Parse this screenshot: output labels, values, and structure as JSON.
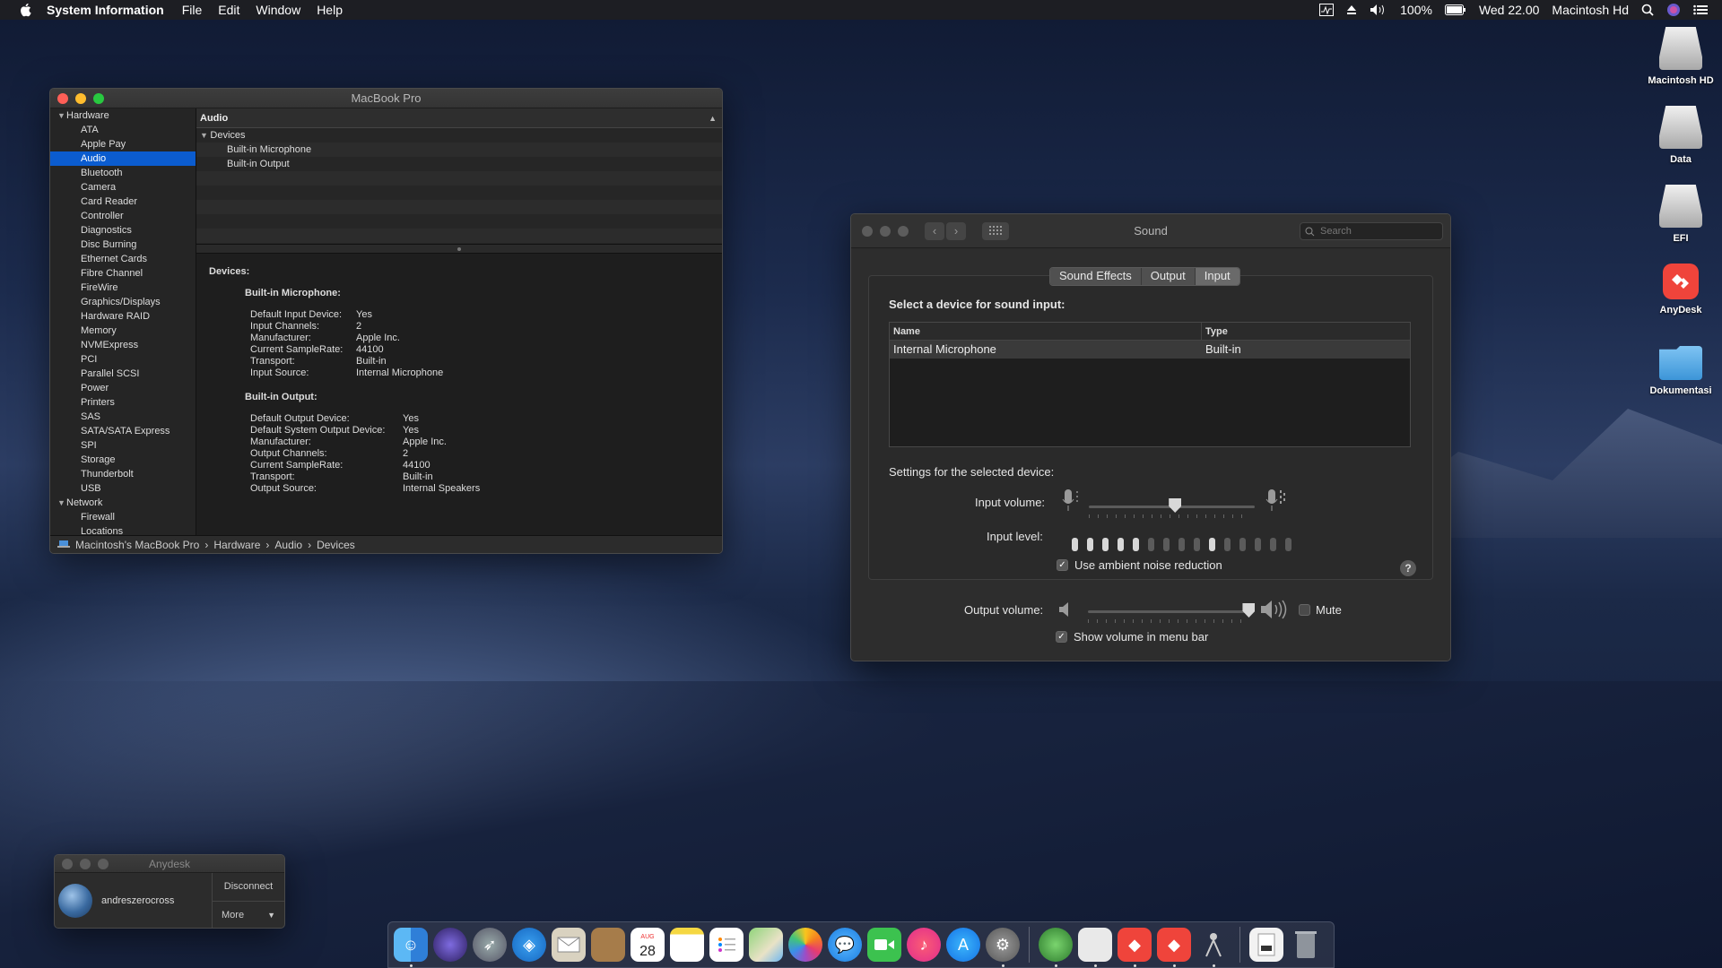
{
  "menubar": {
    "app_name": "System Information",
    "menus": [
      "File",
      "Edit",
      "Window",
      "Help"
    ],
    "battery": "100%",
    "clock": "Wed 22.00",
    "user": "Macintosh Hd"
  },
  "sysinfo": {
    "title": "MacBook Pro",
    "sidebar": {
      "hardware_label": "Hardware",
      "hardware_items": [
        "ATA",
        "Apple Pay",
        "Audio",
        "Bluetooth",
        "Camera",
        "Card Reader",
        "Controller",
        "Diagnostics",
        "Disc Burning",
        "Ethernet Cards",
        "Fibre Channel",
        "FireWire",
        "Graphics/Displays",
        "Hardware RAID",
        "Memory",
        "NVMExpress",
        "PCI",
        "Parallel SCSI",
        "Power",
        "Printers",
        "SAS",
        "SATA/SATA Express",
        "SPI",
        "Storage",
        "Thunderbolt",
        "USB"
      ],
      "selected": "Audio",
      "network_label": "Network",
      "network_items": [
        "Firewall",
        "Locations"
      ]
    },
    "table": {
      "column": "Audio",
      "group": "Devices",
      "rows": [
        "Built-in Microphone",
        "Built-in Output"
      ]
    },
    "detail": {
      "heading": "Devices:",
      "mic_title": "Built-in Microphone:",
      "mic_fields": [
        {
          "k": "Default Input Device:",
          "v": "Yes"
        },
        {
          "k": "Input Channels:",
          "v": "2"
        },
        {
          "k": "Manufacturer:",
          "v": "Apple Inc."
        },
        {
          "k": "Current SampleRate:",
          "v": "44100"
        },
        {
          "k": "Transport:",
          "v": "Built-in"
        },
        {
          "k": "Input Source:",
          "v": "Internal Microphone"
        }
      ],
      "out_title": "Built-in Output:",
      "out_fields": [
        {
          "k": "Default Output Device:",
          "v": "Yes"
        },
        {
          "k": "Default System Output Device:",
          "v": "Yes"
        },
        {
          "k": "Manufacturer:",
          "v": "Apple Inc."
        },
        {
          "k": "Output Channels:",
          "v": "2"
        },
        {
          "k": "Current SampleRate:",
          "v": "44100"
        },
        {
          "k": "Transport:",
          "v": "Built-in"
        },
        {
          "k": "Output Source:",
          "v": "Internal Speakers"
        }
      ]
    },
    "path": [
      "Macintosh's MacBook Pro",
      "Hardware",
      "Audio",
      "Devices"
    ]
  },
  "sound": {
    "title": "Sound",
    "search_placeholder": "Search",
    "tabs": [
      "Sound Effects",
      "Output",
      "Input"
    ],
    "selected_tab": "Input",
    "select_label": "Select a device for sound input:",
    "col_name": "Name",
    "col_type": "Type",
    "device_name": "Internal Microphone",
    "device_type": "Built-in",
    "settings_label": "Settings for the selected device:",
    "input_volume_label": "Input volume:",
    "input_volume": 0.52,
    "input_level_label": "Input level:",
    "input_level_lit": [
      1,
      1,
      1,
      1,
      1,
      0,
      0,
      0,
      0,
      1,
      0,
      0,
      0,
      0,
      0
    ],
    "ambient_label": "Use ambient noise reduction",
    "ambient_checked": true,
    "help": "?",
    "output_volume_label": "Output volume:",
    "output_volume": 0.97,
    "mute_label": "Mute",
    "mute_checked": false,
    "menu_bar_label": "Show volume in menu bar",
    "menu_bar_checked": true
  },
  "anydesk": {
    "title": "Anydesk",
    "user": "andreszerocross",
    "disconnect": "Disconnect",
    "more": "More"
  },
  "desktop_icons": [
    {
      "label": "Macintosh HD",
      "icon": "hdd-icon"
    },
    {
      "label": "Data",
      "icon": "hdd-icon"
    },
    {
      "label": "EFI",
      "icon": "hdd-icon"
    },
    {
      "label": "AnyDesk",
      "icon": "anydesk-icon"
    },
    {
      "label": "Dokumentasi",
      "icon": "folder-icon"
    }
  ],
  "dock": {
    "calendar_month": "AUG",
    "calendar_day": "28"
  },
  "colors": {
    "selection": "#0b5ccf",
    "close": "#ff5f57",
    "minimize": "#ffbd2e",
    "zoom": "#28c940",
    "anydesk_red": "#ef443b"
  }
}
